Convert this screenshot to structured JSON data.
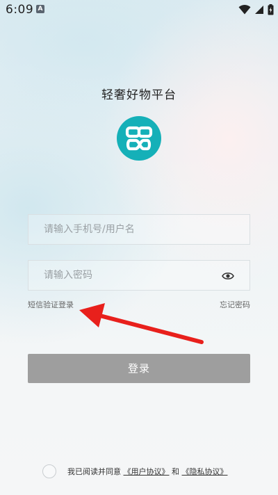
{
  "status_bar": {
    "time": "6:09",
    "notification_icon": "a-badge-icon",
    "icons": [
      "wifi-icon",
      "signal-icon",
      "battery-icon"
    ]
  },
  "app": {
    "title": "轻奢好物平台",
    "logo_icon": "infinity-link-logo",
    "brand_color": "#15b0b8"
  },
  "login_form": {
    "username_placeholder": "请输入手机号/用户名",
    "username_value": "",
    "password_placeholder": "请输入密码",
    "password_value": "",
    "password_toggle_icon": "eye-icon",
    "sms_login_label": "短信验证登录",
    "forgot_password_label": "忘记密码",
    "login_button_label": "登录",
    "login_button_color": "#9e9e9e"
  },
  "agreement": {
    "checked": false,
    "prefix": "我已阅读并同意",
    "user_agreement_link": "《用户协议》",
    "conjunction": "和",
    "privacy_link": "《隐私协议》"
  },
  "annotation": {
    "arrow_color": "#e8201c",
    "arrow_icon": "red-arrow-pointer"
  }
}
